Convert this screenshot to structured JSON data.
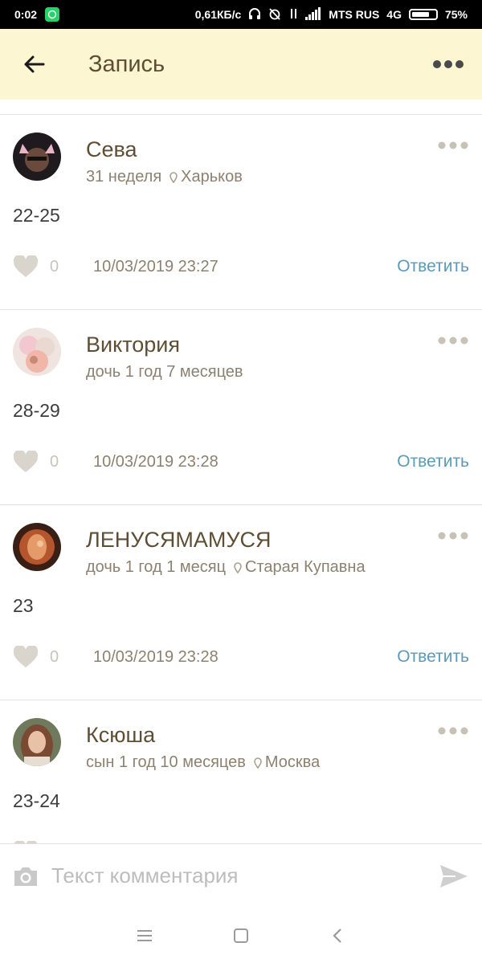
{
  "status_bar": {
    "time": "0:02",
    "speed": "0,61КБ/с",
    "carrier": "MTS RUS",
    "network": "4G",
    "battery": "75%",
    "battery_level": 0.75
  },
  "app_bar": {
    "title": "Запись"
  },
  "comments": [
    {
      "name": "Сева",
      "meta": "31 неделя",
      "location": "Харьков",
      "text": "22-25",
      "likes": "0",
      "date": "10/03/2019 23:27",
      "reply_label": "Ответить"
    },
    {
      "name": "Виктория",
      "meta": "дочь 1 год 7 месяцев",
      "location": "",
      "text": "28-29",
      "likes": "0",
      "date": "10/03/2019 23:28",
      "reply_label": "Ответить"
    },
    {
      "name": "ЛЕНУСЯМАМУСЯ",
      "meta": "дочь 1 год 1 месяц",
      "location": "Старая Купавна",
      "text": "23",
      "likes": "0",
      "date": "10/03/2019 23:28",
      "reply_label": "Ответить"
    },
    {
      "name": "Ксюша",
      "meta": "сын 1 год 10 месяцев",
      "location": "Москва",
      "text": "23-24",
      "likes": "0",
      "date": "",
      "reply_label": ""
    }
  ],
  "comment_input": {
    "placeholder": "Текст комментария"
  },
  "colors": {
    "app_bar_bg": "#fcf6d2",
    "title": "#5f4e34",
    "reply": "#5a9bb8",
    "meta": "#8d8170"
  }
}
